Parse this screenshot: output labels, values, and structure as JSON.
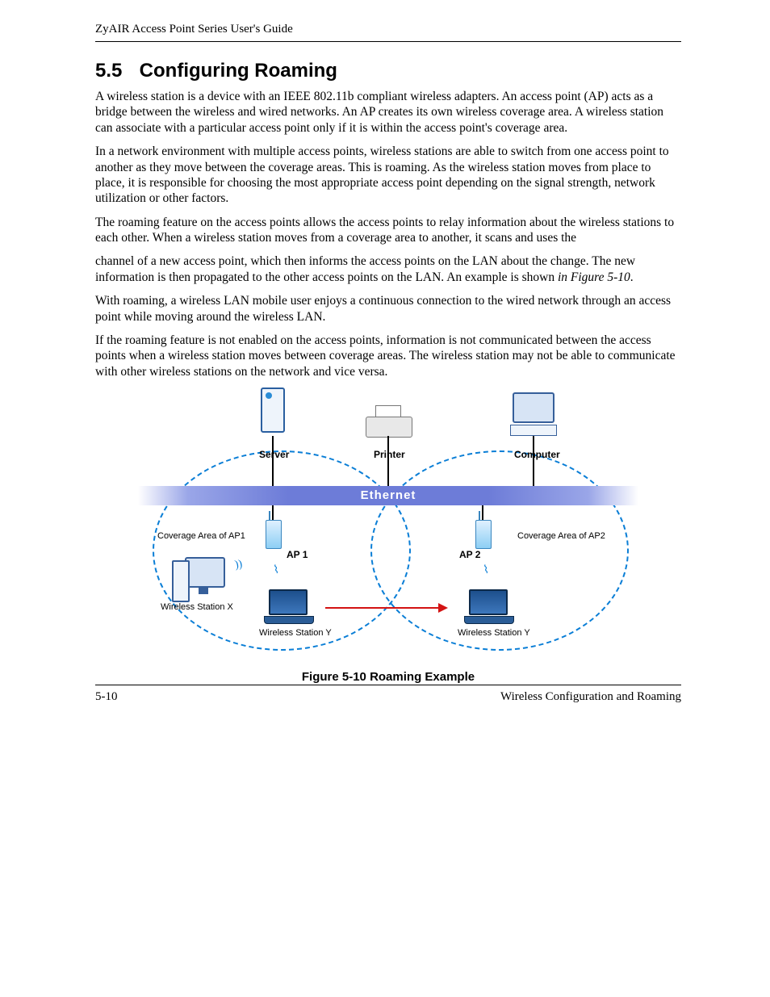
{
  "header": {
    "running_head": "ZyAIR Access Point Series User's Guide"
  },
  "section": {
    "number": "5.5",
    "title": "Configuring Roaming"
  },
  "paragraphs": {
    "p1": "A wireless station is a device with an IEEE 802.11b compliant wireless adapters. An access point (AP) acts as a bridge between the wireless and wired networks. An AP creates its own wireless coverage area. A wireless station can associate with a particular access point only if it is within the access point's coverage area.",
    "p2": "In a network environment with multiple access points, wireless stations are able to switch from one access point to another as they move between the coverage areas. This is roaming. As the wireless station moves from place to place, it is responsible for choosing the most appropriate access point depending on the signal strength, network utilization or other factors.",
    "p3a": "The roaming feature on the access points allows the access points to relay information about the wireless stations to each other. When a wireless station moves from a coverage area to another, it scans and uses the",
    "p3b_pre_ref": "channel of a new access point, which then informs the access points on the LAN about the change. The new information is then propagated to the other access points on the LAN. An example is shown ",
    "p3b_ref": "in Figure 5-10",
    "p3b_post_ref": ".",
    "p4": "With roaming, a wireless LAN mobile user enjoys a continuous connection to the wired network through an access point while moving around the wireless LAN.",
    "p5": "If the roaming feature is not enabled on the access points, information is not communicated between the access points when a wireless station moves between coverage areas.  The wireless station may not be able to communicate with other wireless stations on the network and vice versa."
  },
  "figure": {
    "caption": "Figure 5-10 Roaming Example",
    "labels": {
      "ethernet": "Ethernet",
      "server": "Server",
      "printer": "Printer",
      "computer": "Computer",
      "coverage_ap1": "Coverage Area of AP1",
      "coverage_ap2": "Coverage Area of AP2",
      "ap1": "AP 1",
      "ap2": "AP 2",
      "ws_x": "Wireless Station X",
      "ws_y_left": "Wireless Station Y",
      "ws_y_right": "Wireless Station Y"
    }
  },
  "footer": {
    "page_number": "5-10",
    "chapter": "Wireless Configuration and Roaming"
  }
}
